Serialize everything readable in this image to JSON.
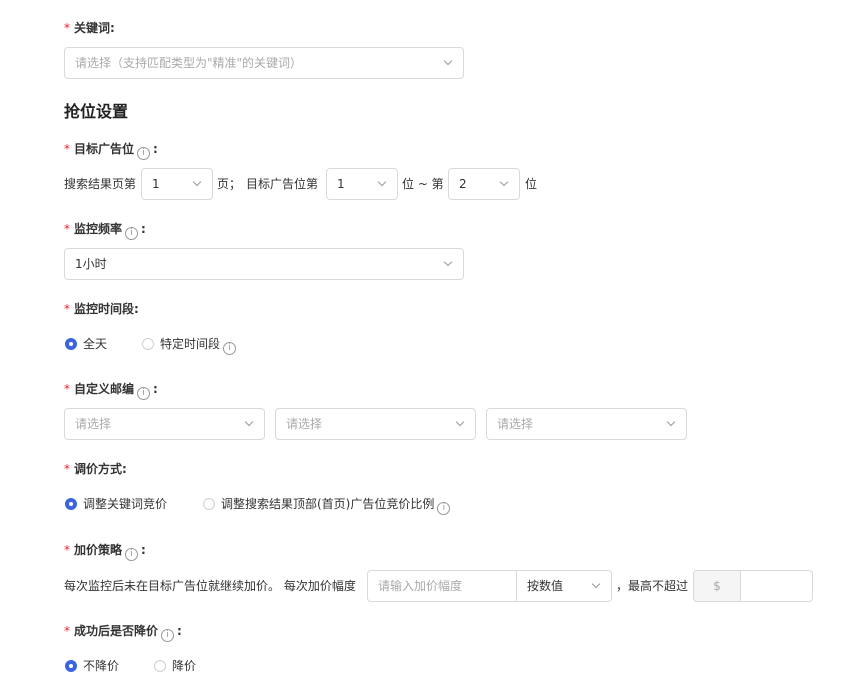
{
  "keyword": {
    "label": "关键词:",
    "placeholder": "请选择（支持匹配类型为\"精准\"的关键词）"
  },
  "section_title": "抢位设置",
  "target_position": {
    "label": "目标广告位",
    "colon": ":",
    "prefix": "搜索结果页第",
    "page_value": "1",
    "page_suffix": "页；",
    "position_prefix": "目标广告位第",
    "position_from": "1",
    "position_middle": "位 ~ 第",
    "position_to": "2",
    "position_suffix": "位"
  },
  "frequency": {
    "label": "监控频率",
    "colon": ":",
    "value": "1小时"
  },
  "time_period": {
    "label": "监控时间段:",
    "options": [
      "全天",
      "特定时间段"
    ],
    "selected": "全天"
  },
  "zipcode": {
    "label": "自定义邮编",
    "colon": ":",
    "placeholders": [
      "请选择",
      "请选择",
      "请选择"
    ]
  },
  "bid_method": {
    "label": "调价方式:",
    "options": [
      "调整关键词竞价",
      "调整搜索结果顶部(首页)广告位竞价比例"
    ],
    "selected": "调整关键词竞价"
  },
  "bid_strategy": {
    "label": "加价策略",
    "colon": ":",
    "description": "每次监控后未在目标广告位就继续加价。 每次加价幅度",
    "increment_placeholder": "请输入加价幅度",
    "mode_value": "按数值",
    "max_prefix": "，最高不超过",
    "currency": "$"
  },
  "lower_after_success": {
    "label": "成功后是否降价",
    "colon": ":",
    "options": [
      "不降价",
      "降价"
    ],
    "selected": "不降价"
  },
  "icons": {
    "info": "i"
  },
  "colors": {
    "required": "#f5222d",
    "accent": "#3a64e0"
  }
}
